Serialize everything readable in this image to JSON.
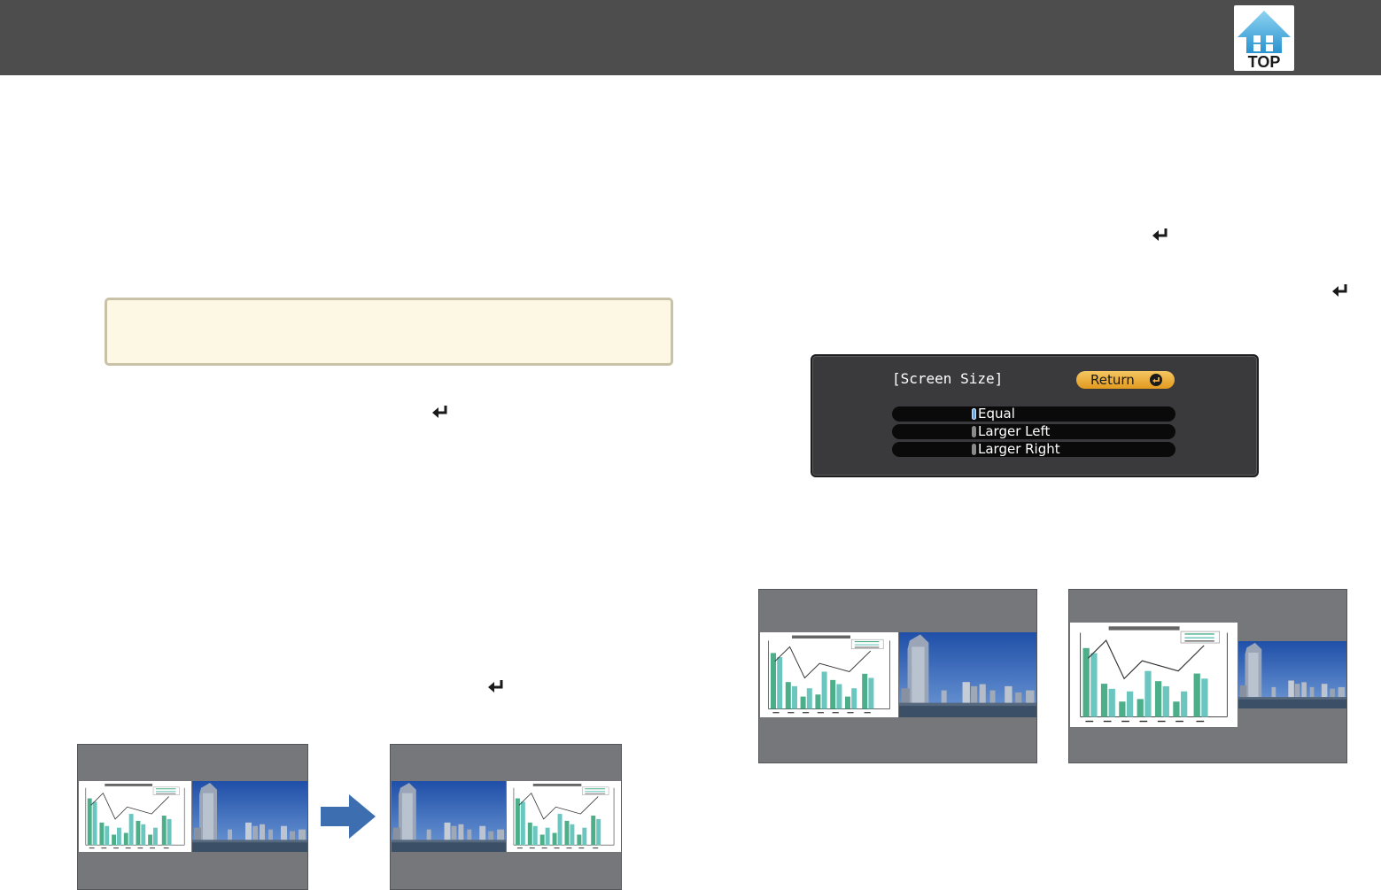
{
  "header": {
    "top_icon_label": "TOP",
    "top_icon_name": "home-top-icon",
    "bar_color": "#4d4d4d"
  },
  "osd_menu": {
    "title": "[Screen Size]",
    "return_label": "Return",
    "options": [
      {
        "label": "Equal",
        "selected": true
      },
      {
        "label": "Larger Left",
        "selected": false
      },
      {
        "label": "Larger Right",
        "selected": false
      }
    ],
    "accent_color": "#f0b03a"
  },
  "icons": {
    "enter": "enter-key-icon",
    "arrow": "right-arrow-icon",
    "chart": "bar-line-chart-illustration",
    "photo": "city-skyline-photo"
  },
  "colors": {
    "note_background": "#fdf8e4",
    "thumbnail_background": "#75777b",
    "bar_color": "#4caf8a",
    "bar_color_light": "#6cc6c0",
    "arrow_color": "#3d6eb0"
  }
}
